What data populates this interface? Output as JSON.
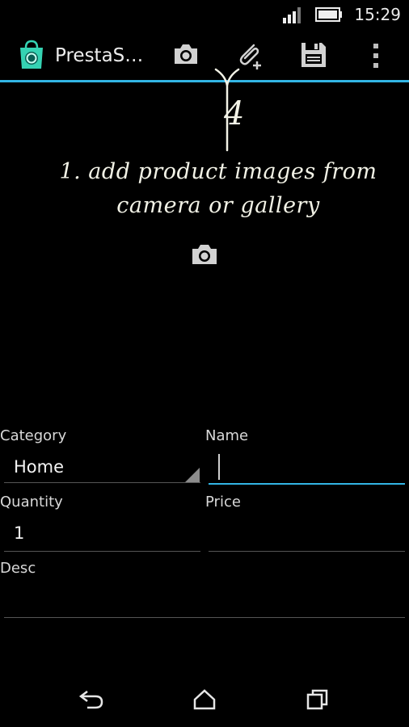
{
  "status_bar": {
    "time": "15:29"
  },
  "action_bar": {
    "app_title": "PrestaS…",
    "icons": [
      "shop-bag-icon",
      "camera-icon",
      "attach-icon",
      "save-icon",
      "overflow-icon"
    ]
  },
  "hint": {
    "arrow_label": "4",
    "line1": "1. add product images from",
    "line2": "camera or gallery"
  },
  "form": {
    "category_label": "Category",
    "category_value": "Home",
    "name_label": "Name",
    "name_value": "",
    "quantity_label": "Quantity",
    "quantity_value": "1",
    "price_label": "Price",
    "price_value": "",
    "desc_label": "Desc",
    "desc_value": ""
  },
  "nav_bar": {
    "icons": [
      "back-icon",
      "home-icon",
      "recents-icon"
    ]
  },
  "colors": {
    "accent": "#33b5e5",
    "background": "#000000",
    "app_icon": "#35d3b3"
  }
}
